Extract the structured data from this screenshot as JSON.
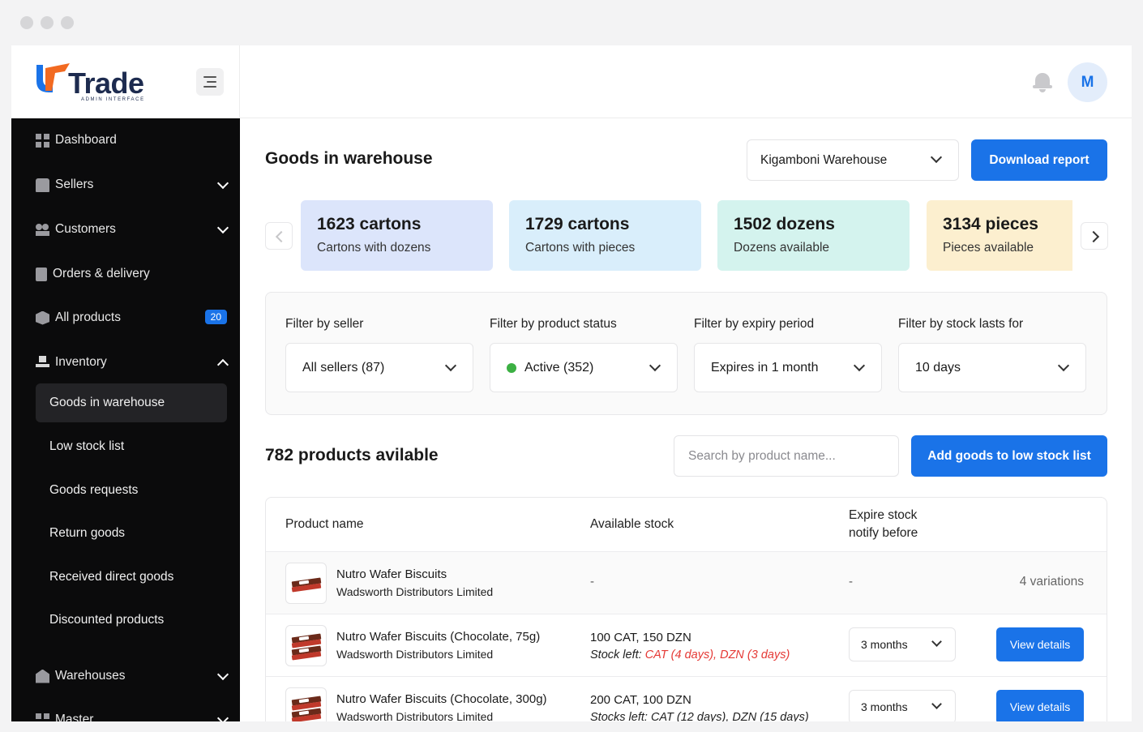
{
  "brand": {
    "name": "Trade",
    "sub": "ADMIN INTERFACE"
  },
  "user": {
    "initial": "M"
  },
  "sidebar": {
    "items": [
      {
        "label": "Dashboard"
      },
      {
        "label": "Sellers"
      },
      {
        "label": "Customers"
      },
      {
        "label": "Orders & delivery"
      },
      {
        "label": "All products",
        "badge": "20"
      },
      {
        "label": "Inventory"
      },
      {
        "label": "Warehouses"
      },
      {
        "label": "Master"
      }
    ],
    "inventory_sub": [
      {
        "label": "Goods in warehouse"
      },
      {
        "label": "Low stock list"
      },
      {
        "label": "Goods requests"
      },
      {
        "label": "Return goods"
      },
      {
        "label": "Received direct goods"
      },
      {
        "label": "Discounted products"
      }
    ]
  },
  "header": {
    "title": "Goods in warehouse",
    "warehouse": "Kigamboni Warehouse",
    "download_label": "Download report"
  },
  "stats": [
    {
      "value": "1623 cartons",
      "label": "Cartons with dozens",
      "color": "#dce5fb"
    },
    {
      "value": "1729 cartons",
      "label": "Cartons with pieces",
      "color": "#d9eefb"
    },
    {
      "value": "1502 dozens",
      "label": "Dozens available",
      "color": "#d4f3ee"
    },
    {
      "value": "3134 pieces",
      "label": "Pieces available",
      "color": "#fcefcf"
    }
  ],
  "filters": [
    {
      "label": "Filter by seller",
      "value": "All sellers (87)"
    },
    {
      "label": "Filter by product status",
      "value": "Active (352)"
    },
    {
      "label": "Filter by expiry period",
      "value": "Expires in 1 month"
    },
    {
      "label": "Filter by stock lasts for",
      "value": "10 days"
    }
  ],
  "products": {
    "count_title": "782 products avilable",
    "search_placeholder": "Search by product name...",
    "add_label": "Add goods to low stock list",
    "columns": {
      "name": "Product name",
      "stock": "Available stock",
      "expire_1": "Expire stock",
      "expire_2": "notify before"
    },
    "rows": [
      {
        "name": "Nutro Wafer Biscuits",
        "seller": "Wadsworth Distributors Limited",
        "stock_dash": "-",
        "expire_dash": "-",
        "variations": "4 variations"
      },
      {
        "name": "Nutro Wafer Biscuits (Chocolate, 75g)",
        "seller": "Wadsworth Distributors Limited",
        "stock": "100 CAT, 150 DZN",
        "stock_left_label": "Stock left: ",
        "stock_left_value": "CAT (4 days), DZN (3 days)",
        "notify": "3 months",
        "action": "View details"
      },
      {
        "name": "Nutro Wafer Biscuits (Chocolate, 300g)",
        "seller": "Wadsworth Distributors Limited",
        "stock": "200 CAT, 100 DZN",
        "stock_left_label": "Stocks left: ",
        "stock_left_value": "CAT (12 days), DZN (15 days)",
        "notify": "3 months",
        "action": "View details"
      }
    ]
  },
  "colors": {
    "accent": "#1a73e8",
    "sidebar_bg": "#0b0b0c",
    "active_dot": "#3cb043",
    "warning": "#e53935"
  }
}
